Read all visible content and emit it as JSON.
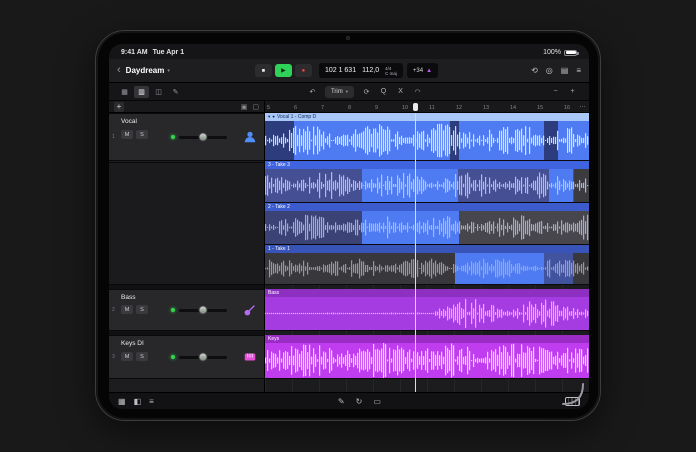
{
  "status": {
    "time": "9:41 AM",
    "date": "Tue Apr 1",
    "battery": "100%"
  },
  "header": {
    "title": "Daydream"
  },
  "lcd": {
    "position": "102 1 631",
    "tempo": "112,0",
    "timesig": "4/4",
    "key": "C maj",
    "extra": "+34"
  },
  "toolbar2": {
    "trim": "Trim"
  },
  "ruler": {
    "ticks": [
      "5",
      "6",
      "7",
      "8",
      "9",
      "10",
      "11",
      "12",
      "13",
      "14",
      "15",
      "16"
    ]
  },
  "tracks": {
    "vocal": {
      "num": "1",
      "name": "Vocal",
      "mute": "M",
      "solo": "S"
    },
    "bass": {
      "num": "2",
      "name": "Bass",
      "mute": "M",
      "solo": "S"
    },
    "keys": {
      "num": "3",
      "name": "Keys DI",
      "mute": "M",
      "solo": "S"
    }
  },
  "takes": [
    {
      "label": "3 - Take 3"
    },
    {
      "label": "2 - Take 2"
    },
    {
      "label": "1 - Take 1"
    }
  ],
  "regions": {
    "comp": "Vocal 1 - Comp D",
    "bass": "Bass",
    "keys": "Keys"
  },
  "icons": {
    "back": "‹",
    "chevron_down": "▾",
    "dot": "●",
    "stop": "■",
    "play": "▶",
    "record": "●",
    "metronome": "▲",
    "cycle": "⟲",
    "tuner": "◎",
    "mixer": "▤",
    "menu": "≡",
    "grid_view": "▦",
    "tracks_view": "▥",
    "loops_view": "◫",
    "automation_view": "✎",
    "undo": "↶",
    "loop": "⟳",
    "quantize": "Q",
    "crossfade": "X",
    "glue": "◠",
    "zoom_out": "−",
    "zoom_in": "+",
    "add": "+",
    "more": "…",
    "hdr_a": "▣",
    "hdr_b": "▢",
    "browser": "▦",
    "split": "◧",
    "list": "≡",
    "pencil": "✎",
    "cycle2": "↻",
    "marquee": "▭"
  }
}
